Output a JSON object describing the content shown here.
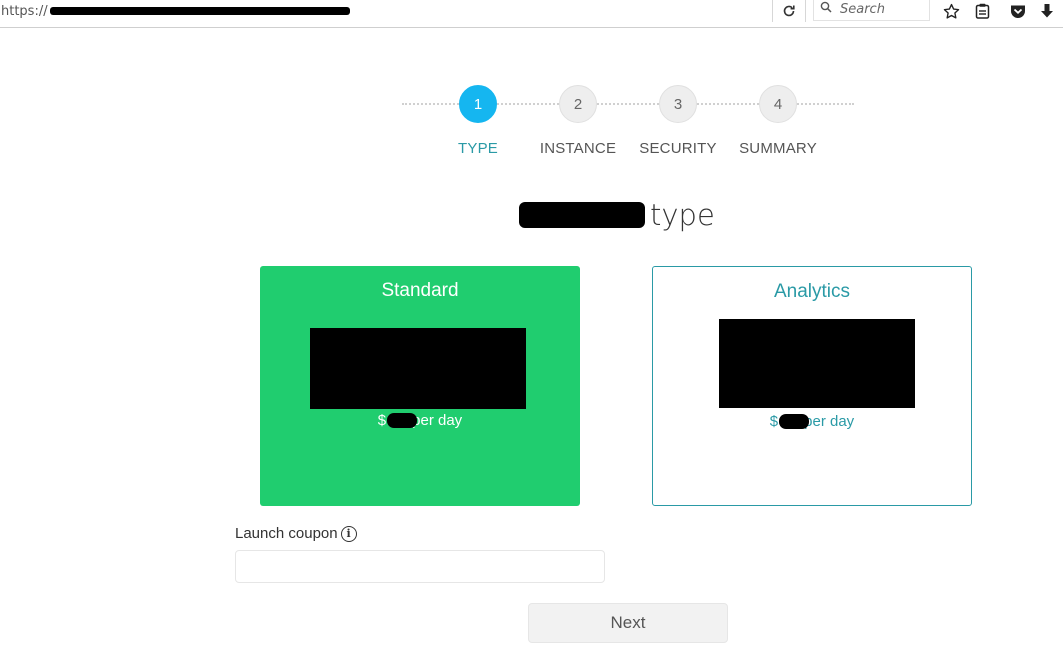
{
  "browser": {
    "url_prefix": "https://",
    "search_placeholder": "Search"
  },
  "stepper": {
    "steps": [
      {
        "number": "1",
        "label": "TYPE",
        "active": true
      },
      {
        "number": "2",
        "label": "INSTANCE",
        "active": false
      },
      {
        "number": "3",
        "label": "SECURITY",
        "active": false
      },
      {
        "number": "4",
        "label": "SUMMARY",
        "active": false
      }
    ]
  },
  "page": {
    "title_suffix": "type"
  },
  "cards": [
    {
      "name": "Standard",
      "price_prefix": "$",
      "price_suffix": "per day",
      "selected": true
    },
    {
      "name": "Analytics",
      "price_prefix": "$",
      "price_suffix": "per day",
      "selected": false
    }
  ],
  "coupon": {
    "label": "Launch coupon",
    "value": "",
    "placeholder": ""
  },
  "next_button": {
    "label": "Next"
  },
  "colors": {
    "accent_blue": "#15b6f0",
    "standard_green": "#20cd6f",
    "teal": "#2a9aa6"
  }
}
